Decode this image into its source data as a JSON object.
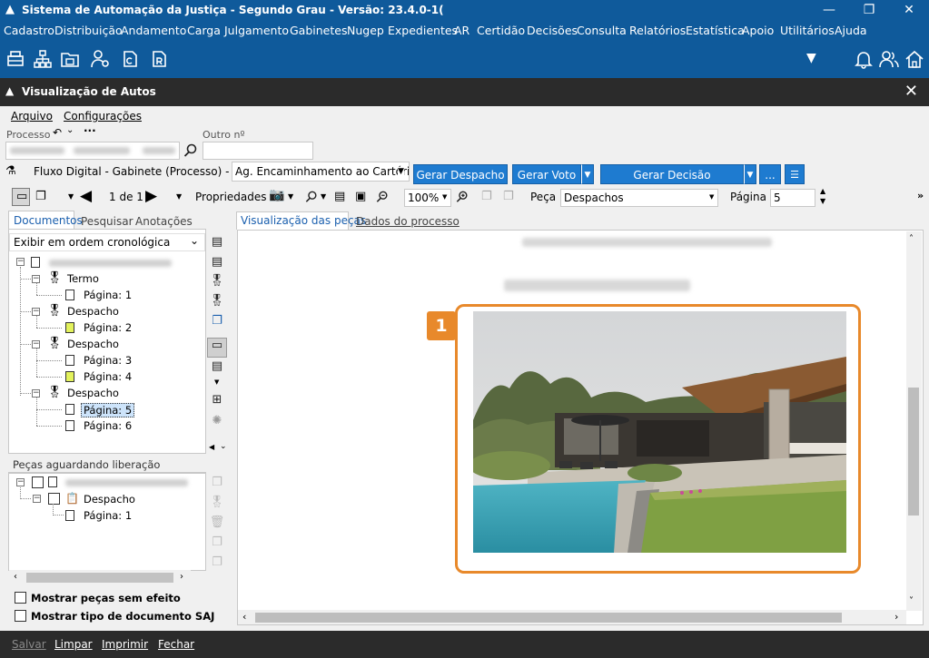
{
  "window": {
    "title": "Sistema de Automação da Justiça - Segundo Grau - Versão: 23.4.0-1("
  },
  "menu": [
    "Cadastro",
    "Distribuição",
    "Andamento",
    "Carga",
    "Julgamento",
    "Gabinetes",
    "Nugep",
    "Expedientes",
    "AR",
    "Certidão",
    "Decisões",
    "Consulta",
    "Relatórios",
    "Estatística",
    "Apoio",
    "Utilitários",
    "Ajuda"
  ],
  "subwindow": {
    "title": "Visualização de Autos"
  },
  "submenu": {
    "arquivo": "Arquivo",
    "configuracoes": "Configurações"
  },
  "processo": {
    "label": "Processo",
    "outro_label": "Outro nº"
  },
  "fluxo": {
    "text": "Fluxo Digital - Gabinete (Processo) - Fila:",
    "fila_value": "Ag. Encaminhamento ao Cartório",
    "btn_despacho": "Gerar Despacho",
    "btn_voto": "Gerar Voto",
    "btn_decisao": "Gerar Decisão Monocrática",
    "btn_more": "..."
  },
  "viewer_toolbar": {
    "page_counter": "1 de 1",
    "propriedades": "Propriedades",
    "zoom": "100%",
    "peca_label": "Peça",
    "peca_value": "Despachos",
    "pagina_label": "Página",
    "pagina_value": "5"
  },
  "left_tabs": [
    "Documentos",
    "Pesquisar",
    "Anotações"
  ],
  "order_select": "Exibir em ordem cronológica",
  "tree": [
    {
      "type": "doc",
      "label": "Termo",
      "pages": [
        {
          "label": "Página: 1",
          "yellow": false
        }
      ]
    },
    {
      "type": "doc",
      "label": "Despacho",
      "pages": [
        {
          "label": "Página: 2",
          "yellow": true
        }
      ]
    },
    {
      "type": "doc",
      "label": "Despacho",
      "pages": [
        {
          "label": "Página: 3",
          "yellow": false
        },
        {
          "label": "Página: 4",
          "yellow": true
        }
      ]
    },
    {
      "type": "doc",
      "label": "Despacho",
      "pages": [
        {
          "label": "Página: 5",
          "yellow": false,
          "selected": true
        },
        {
          "label": "Página: 6",
          "yellow": false
        }
      ]
    }
  ],
  "pending": {
    "title": "Peças aguardando liberação",
    "doc_label": "Despacho",
    "page_label": "Página: 1"
  },
  "checks": {
    "sem_efeito": "Mostrar peças sem efeito",
    "tipo_saj": "Mostrar tipo de documento SAJ"
  },
  "view_tabs": [
    "Visualização das peças",
    "Dados do processo"
  ],
  "marker": "1",
  "bottom": {
    "salvar": "Salvar",
    "limpar": "Limpar",
    "imprimir": "Imprimir",
    "fechar": "Fechar"
  },
  "colors": {
    "primary": "#0f5a9b",
    "accent": "#e8892b",
    "button": "#1e7bd0",
    "dark": "#2b2b2b"
  }
}
